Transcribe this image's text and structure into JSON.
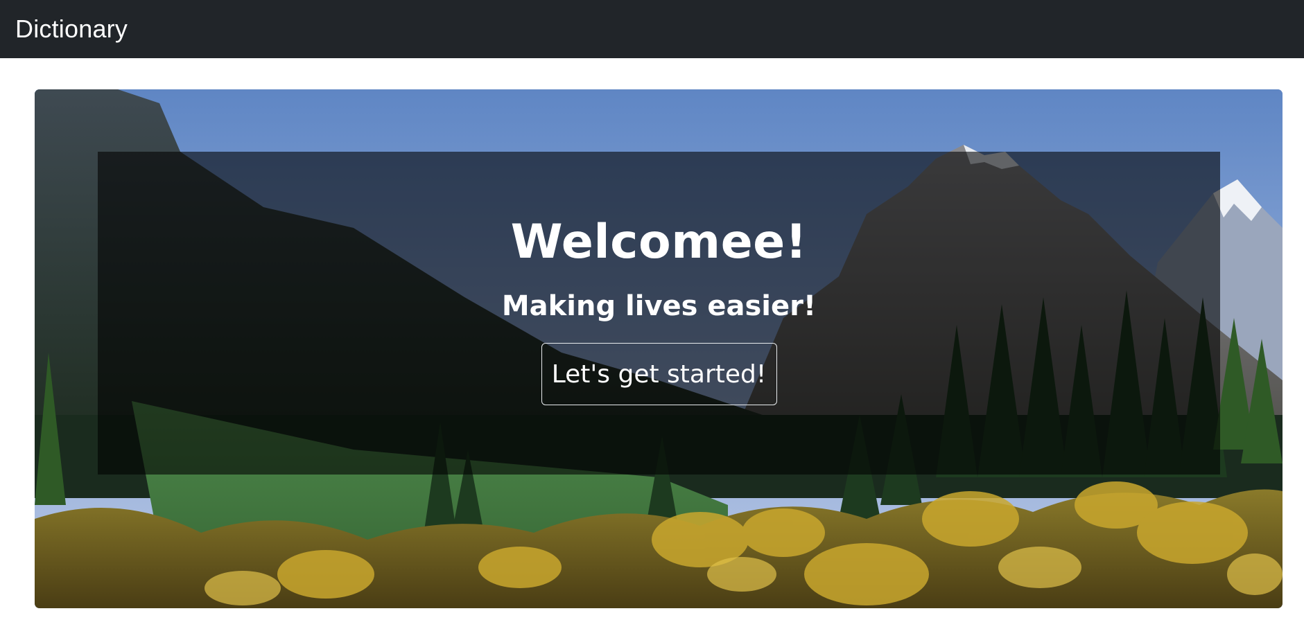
{
  "navbar": {
    "brand": "Dictionary",
    "background": "#212529"
  },
  "hero": {
    "background_image": "mountain-forest-landscape",
    "title": "Welcomee!",
    "subtitle": "Making lives easier!",
    "cta_label": "Let's get started!",
    "overlay_color": "#000000"
  }
}
